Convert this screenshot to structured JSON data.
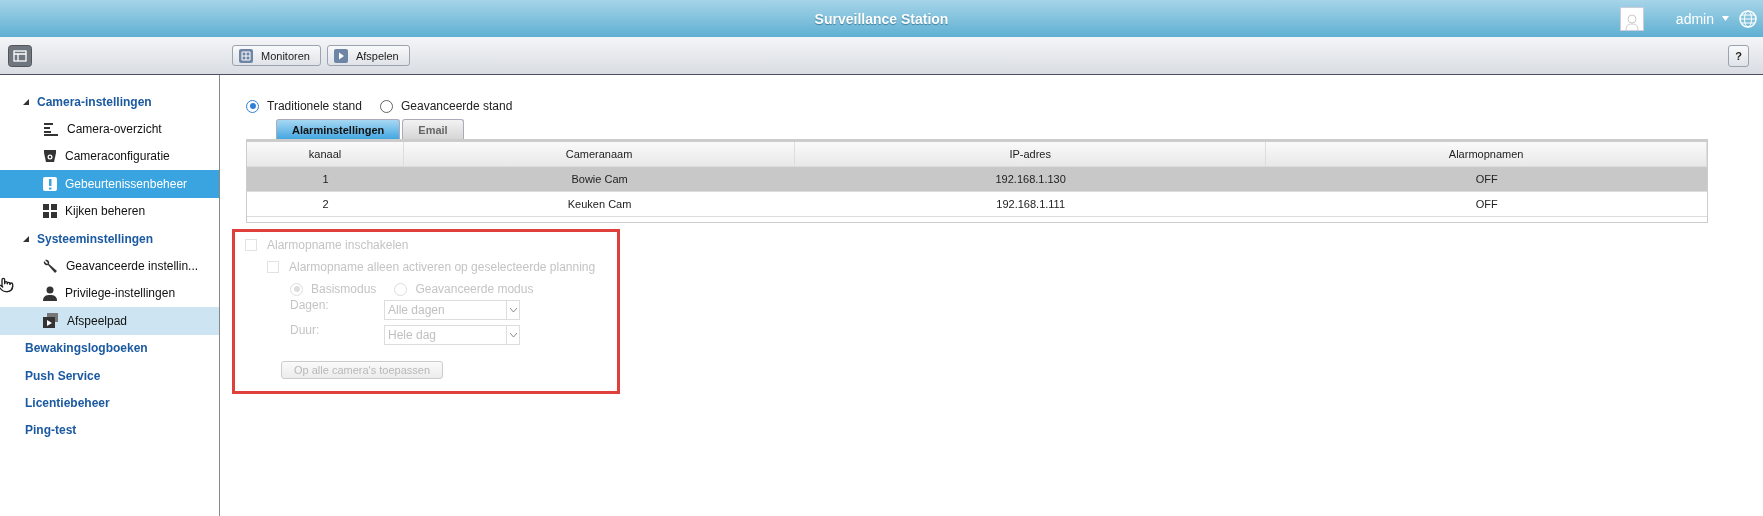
{
  "header": {
    "title": "Surveillance Station",
    "user": "admin"
  },
  "toolbar": {
    "buttons": [
      {
        "label": "Monitoren"
      },
      {
        "label": "Afspelen"
      }
    ],
    "help": "?"
  },
  "sidebar": {
    "items": [
      {
        "label": "Camera-instellingen",
        "expanded": true,
        "selected": false,
        "hovered": false,
        "children": [
          {
            "label": "Camera-overzicht",
            "selected": false,
            "hovered": false
          },
          {
            "label": "Cameraconfiguratie",
            "selected": false,
            "hovered": false
          },
          {
            "label": "Gebeurtenissenbeheer",
            "selected": true,
            "hovered": false
          },
          {
            "label": "Kijken beheren",
            "selected": false,
            "hovered": false
          }
        ]
      },
      {
        "label": "Systeeminstellingen",
        "expanded": true,
        "selected": false,
        "hovered": false,
        "children": [
          {
            "label": "Geavanceerde instellin...",
            "selected": false,
            "hovered": false
          },
          {
            "label": "Privilege-instellingen",
            "selected": false,
            "hovered": false
          },
          {
            "label": "Afspeelpad",
            "selected": false,
            "hovered": true
          }
        ]
      },
      {
        "label": "Bewakingslogboeken",
        "selected": false,
        "hovered": false
      },
      {
        "label": "Push Service",
        "selected": false,
        "hovered": false
      },
      {
        "label": "Licentiebeheer",
        "selected": false,
        "hovered": false
      },
      {
        "label": "Ping-test",
        "selected": false,
        "hovered": false
      }
    ]
  },
  "mode": [
    {
      "label": "Traditionele stand",
      "selected": true
    },
    {
      "label": "Geavanceerde stand",
      "selected": false
    }
  ],
  "tabs": [
    {
      "label": "Alarminstellingen",
      "selected": true
    },
    {
      "label": "Email",
      "selected": false
    }
  ],
  "table": {
    "columns": [
      "kanaal",
      "Cameranaam",
      "IP-adres",
      "Alarmopnamen"
    ],
    "rows": [
      {
        "cells": [
          "1",
          "Bowie Cam",
          "192.168.1.130",
          "OFF"
        ],
        "selected": true
      },
      {
        "cells": [
          "2",
          "Keuken Cam",
          "192.168.1.111",
          "OFF"
        ],
        "selected": false
      }
    ]
  },
  "alarm_form": {
    "highlighted": true,
    "enable": {
      "label": "Alarmopname inschakelen",
      "checked": false,
      "disabled": true
    },
    "schedule_only": {
      "label": "Alarmopname alleen activeren op geselecteerde planning",
      "checked": false,
      "disabled": true
    },
    "modes": [
      {
        "label": "Basismodus",
        "selected": true,
        "disabled": true
      },
      {
        "label": "Geavanceerde modus",
        "selected": false,
        "disabled": true
      }
    ],
    "fields": [
      {
        "label": "Dagen:",
        "value": "Alle dagen",
        "disabled": true
      },
      {
        "label": "Duur:",
        "value": "Hele dag",
        "disabled": true
      }
    ],
    "apply_button": {
      "label": "Op alle camera's toepassen",
      "disabled": true
    }
  }
}
